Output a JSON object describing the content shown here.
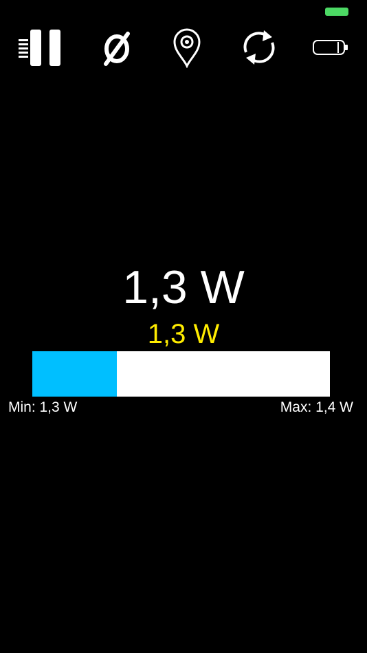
{
  "colors": {
    "background": "#000000",
    "foreground": "#ffffff",
    "accent_yellow": "#ffec00",
    "accent_blue": "#00bfff",
    "status_green": "#4cd964"
  },
  "status_bar": {
    "battery_icon": "battery-full-icon"
  },
  "toolbar": {
    "items": [
      {
        "id": "pause",
        "icon": "pause-icon"
      },
      {
        "id": "zero",
        "icon": "null-icon"
      },
      {
        "id": "location",
        "icon": "location-pin-icon"
      },
      {
        "id": "refresh",
        "icon": "refresh-icon"
      },
      {
        "id": "battery",
        "icon": "battery-icon"
      }
    ]
  },
  "measurement": {
    "current": "1,3 W",
    "reference": "1,3 W",
    "min_label": "Min: 1,3 W",
    "max_label": "Max: 1,4 W",
    "fill_fraction": 0.285
  }
}
